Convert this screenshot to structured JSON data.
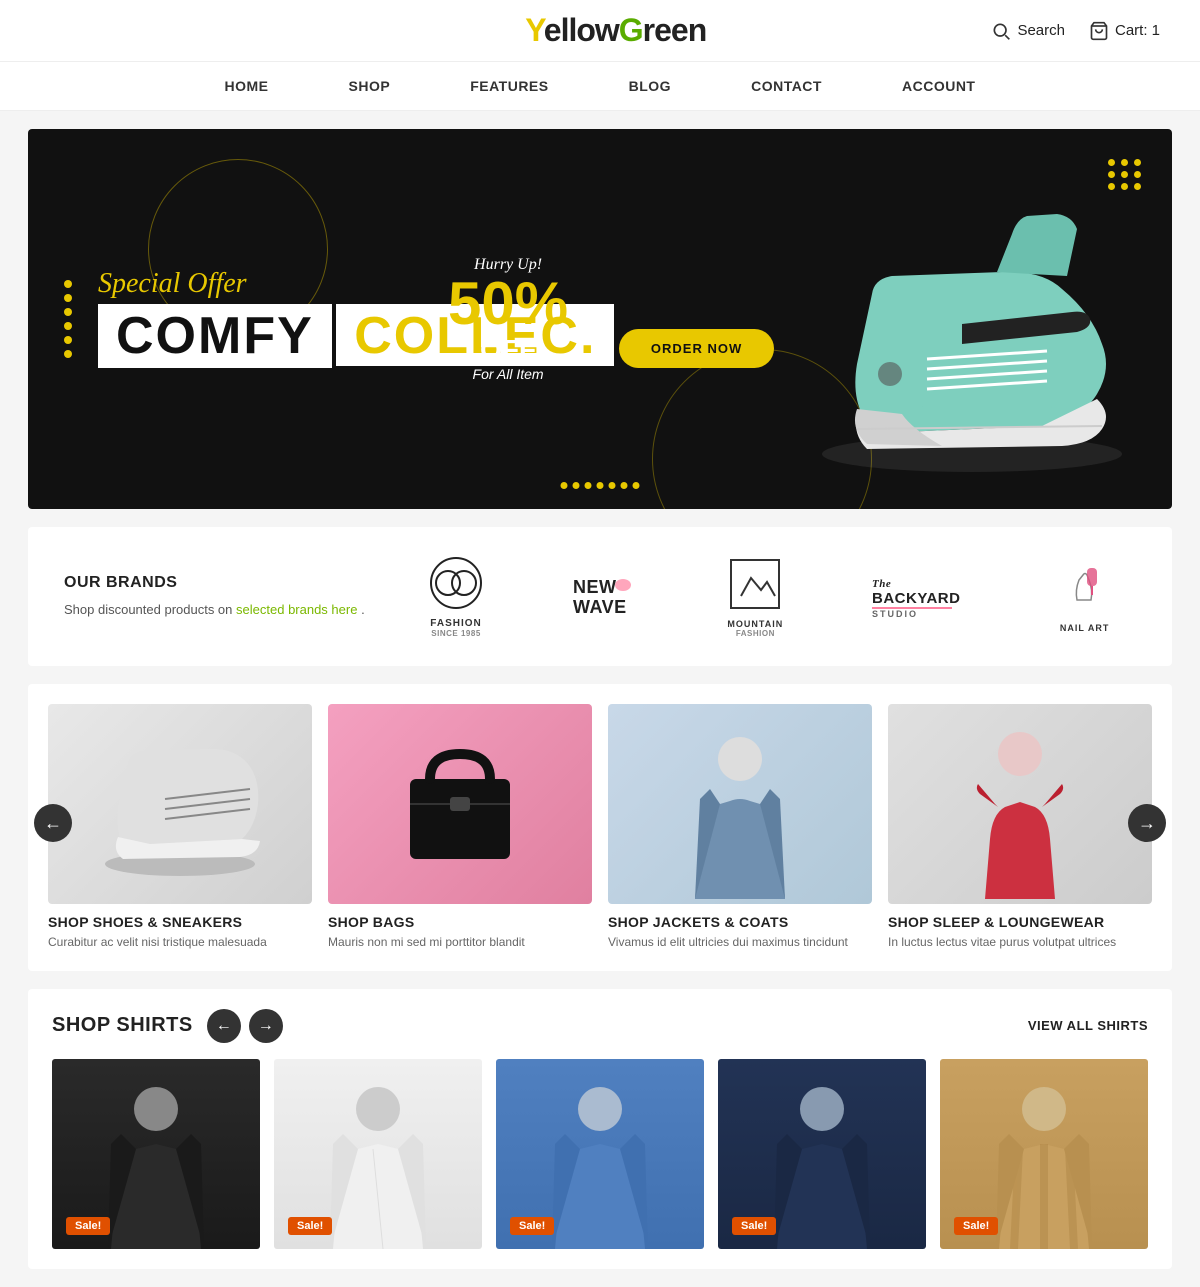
{
  "header": {
    "logo": {
      "y": "Y",
      "ellow": "ellow",
      "g": "G",
      "reen": "reen"
    },
    "search_label": "Search",
    "cart_label": "Cart: 1"
  },
  "nav": {
    "items": [
      {
        "label": "HOME"
      },
      {
        "label": "SHOP"
      },
      {
        "label": "FEATURES"
      },
      {
        "label": "BLOG"
      },
      {
        "label": "CONTACT"
      },
      {
        "label": "ACCOUNT"
      }
    ]
  },
  "hero": {
    "special_offer": "Special Offer",
    "title_line1": "COMFY",
    "title_line2": "COLLEC.",
    "hurry": "Hurry Up!",
    "percent": "50%",
    "off": "OFF",
    "for_all": "For All Item",
    "btn_label": "ORDER NOW"
  },
  "brands": {
    "title": "OUR BRANDS",
    "desc": "Shop discounted products on",
    "link_text": "selected brands here",
    "link_suffix": " .",
    "logos": [
      {
        "name": "FASHION",
        "sub": "SINCE 1985"
      },
      {
        "name": "NEW WAVE",
        "sub": ""
      },
      {
        "name": "MOUNTAIN",
        "sub": "FASHION"
      },
      {
        "name": "The BACKYARD",
        "sub": "STUDIO"
      },
      {
        "name": "NAIL ART",
        "sub": ""
      }
    ]
  },
  "categories": {
    "arrow_left": "←",
    "arrow_right": "→",
    "items": [
      {
        "title": "SHOP SHOES & SNEAKERS",
        "desc": "Curabitur ac velit nisi tristique malesuada"
      },
      {
        "title": "SHOP BAGS",
        "desc": "Mauris non mi sed mi porttitor blandit"
      },
      {
        "title": "SHOP JACKETS & COATS",
        "desc": "Vivamus id elit ultricies dui maximus tincidunt"
      },
      {
        "title": "SHOP SLEEP & LOUNGEWEAR",
        "desc": "In luctus lectus vitae purus volutpat ultrices"
      }
    ]
  },
  "shirts": {
    "title": "SHOP SHIRTS",
    "view_all": "VIEW ALL SHIRTS",
    "arrow_left": "←",
    "arrow_right": "→",
    "items": [
      {
        "sale": "Sale!"
      },
      {
        "sale": "Sale!"
      },
      {
        "sale": "Sale!"
      },
      {
        "sale": "Sale!"
      },
      {
        "sale": "Sale!"
      }
    ]
  }
}
